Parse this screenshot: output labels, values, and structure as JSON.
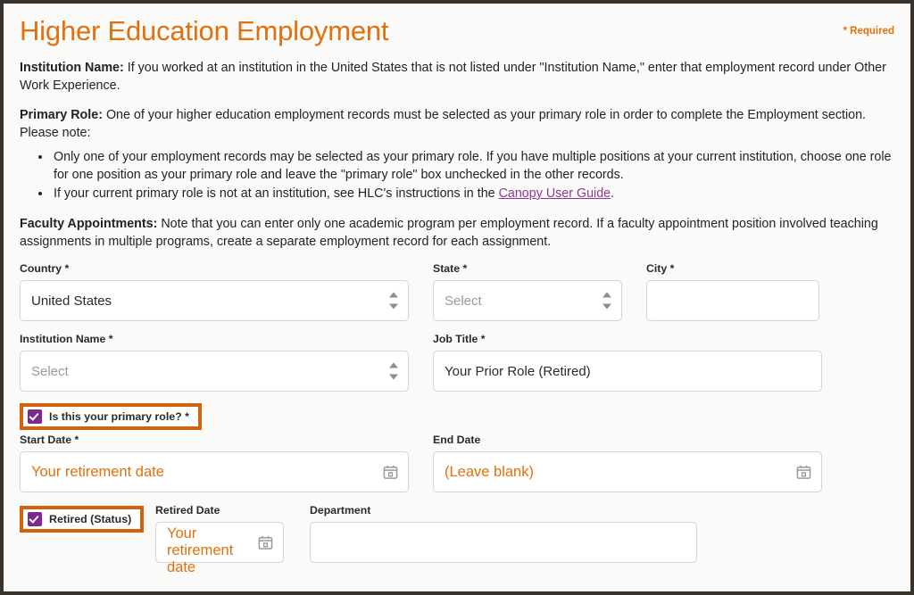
{
  "header": {
    "title": "Higher Education Employment",
    "required_note": "* Required",
    "title_color": "#e2700d"
  },
  "intro": {
    "institution_label": "Institution Name:",
    "institution_text": " If you worked at an institution in the United States that is not listed under \"Institution Name,\" enter that employment record under Other Work Experience.",
    "primary_role_label": "Primary Role:",
    "primary_role_text": " One of your higher education employment records must be selected as your primary role in order to complete the Employment section. Please note:",
    "bullets": [
      "Only one of your employment records may be selected as your primary role. If you have multiple positions at your current institution, choose one role for one position as your primary role and leave the \"primary role\" box unchecked in the other records.",
      "If your current primary role is not at an institution, see HLC's instructions in the "
    ],
    "bullet2_link_text": "Canopy User Guide",
    "bullet2_tail": ".",
    "link_color": "#8e3a95",
    "faculty_label": "Faculty Appointments:",
    "faculty_text": " Note that you can enter only one academic program per employment record. If a faculty appointment position involved teaching assignments in multiple programs, create a separate employment record for each assignment."
  },
  "form": {
    "country": {
      "label": "Country *",
      "value": "United States",
      "control": "select",
      "icon": "spinner-arrows-icon"
    },
    "state": {
      "label": "State *",
      "value": "Select",
      "control": "select",
      "is_placeholder": true,
      "icon": "spinner-arrows-icon"
    },
    "city": {
      "label": "City *",
      "value": "",
      "control": "text"
    },
    "institution_name": {
      "label": "Institution Name *",
      "value": "Select",
      "control": "select",
      "is_placeholder": true,
      "icon": "spinner-arrows-icon"
    },
    "job_title": {
      "label": "Job Title *",
      "value": "Your Prior Role (Retired)",
      "control": "text"
    },
    "primary_role": {
      "label": "Is this your primary role? *",
      "checked": true,
      "checkbox_color": "#7b2a8f",
      "highlight_color": "#d3620a"
    },
    "start_date": {
      "label": "Start Date *",
      "value": "Your retirement date",
      "control": "date",
      "value_color": "#e2700d",
      "icon": "calendar-icon"
    },
    "end_date": {
      "label": "End Date",
      "value": "(Leave blank)",
      "control": "date",
      "value_color": "#e2700d",
      "icon": "calendar-icon"
    },
    "retired_status": {
      "label": "Retired (Status)",
      "checked": true,
      "checkbox_color": "#7b2a8f",
      "highlight_color": "#d3620a"
    },
    "retired_date": {
      "label": "Retired Date",
      "value_line1": "Your",
      "value_line2": "retirement date",
      "control": "date",
      "value_color": "#e2700d",
      "icon": "calendar-icon"
    },
    "department": {
      "label": "Department",
      "value": "",
      "control": "text"
    }
  }
}
